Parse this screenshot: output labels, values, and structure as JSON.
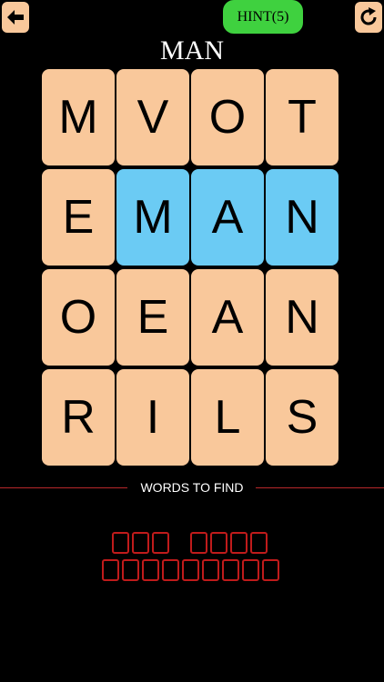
{
  "header": {
    "back_icon": "arrow-left-icon",
    "hint_label": "HINT(5)",
    "refresh_icon": "refresh-icon"
  },
  "current_word": "MAN",
  "grid": {
    "rows": [
      [
        {
          "letter": "M",
          "selected": false
        },
        {
          "letter": "V",
          "selected": false
        },
        {
          "letter": "O",
          "selected": false
        },
        {
          "letter": "T",
          "selected": false
        }
      ],
      [
        {
          "letter": "E",
          "selected": false
        },
        {
          "letter": "M",
          "selected": true
        },
        {
          "letter": "A",
          "selected": true
        },
        {
          "letter": "N",
          "selected": true
        }
      ],
      [
        {
          "letter": "O",
          "selected": false
        },
        {
          "letter": "E",
          "selected": false
        },
        {
          "letter": "A",
          "selected": false
        },
        {
          "letter": "N",
          "selected": false
        }
      ],
      [
        {
          "letter": "R",
          "selected": false
        },
        {
          "letter": "I",
          "selected": false
        },
        {
          "letter": "L",
          "selected": false
        },
        {
          "letter": "S",
          "selected": false
        }
      ]
    ]
  },
  "words_section": {
    "label": "WORDS TO FIND",
    "line_color": "#b8282b",
    "slot_color": "#c01b1b"
  },
  "hidden_words": [
    {
      "lengths": [
        3,
        4
      ]
    },
    {
      "lengths": [
        9
      ]
    }
  ],
  "colors": {
    "tile": "#f9c89b",
    "selected_tile": "#6bcbf4",
    "hint_button": "#3fd13f",
    "background": "#000000"
  }
}
